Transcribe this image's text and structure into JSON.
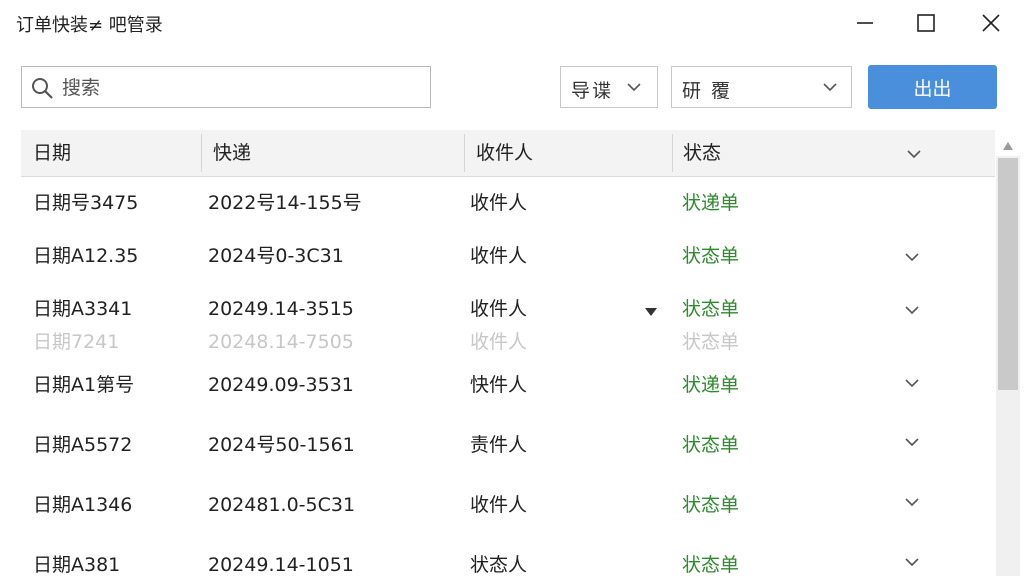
{
  "window": {
    "title": "订单快装≠ 吧管录",
    "controls": [
      "minimize-icon",
      "maximize-icon",
      "close-icon"
    ]
  },
  "toolbar": {
    "search_placeholder": "搜索",
    "dropdown1_label": "导谍",
    "dropdown2_label": "研 覆",
    "primary_button_label": "出出"
  },
  "table": {
    "columns": [
      "日期",
      "快递",
      "收件人",
      "状态"
    ],
    "rows": [
      {
        "date": "日期号3475",
        "express": "2022号14-155号",
        "recipient": "收件人",
        "status": "状递单",
        "chevron": false,
        "triangle": false
      },
      {
        "date": "日期A12.35",
        "express": "2024号0-3С31",
        "recipient": "收件人",
        "status": "状态单",
        "chevron": true,
        "triangle": false
      },
      {
        "date": "日期A3341",
        "express": "20249.14-3515",
        "recipient": "收件人",
        "status": "状态单",
        "chevron": true,
        "triangle": true
      },
      {
        "date": "日期A1第号",
        "express": "20249.09-3531",
        "recipient": "快件人",
        "status": "状递单",
        "chevron": true,
        "triangle": false
      },
      {
        "date": "日期A5572",
        "express": "2024号50-1561",
        "recipient": "责件人",
        "status": "状态单",
        "chevron": true,
        "triangle": false
      },
      {
        "date": "日期A1346",
        "express": "202481.0-5С31",
        "recipient": "收件人",
        "status": "状态单",
        "chevron": true,
        "triangle": false
      },
      {
        "date": "日期A381",
        "express": "20249.14-1051",
        "recipient": "状态人",
        "status": "状态单",
        "chevron": true,
        "triangle": false
      }
    ],
    "ghost_row": {
      "date": "日期7241",
      "express": "20248.14-7505",
      "recipient": "收件人",
      "status": "状态单"
    }
  },
  "colors": {
    "accent": "#4a8fdb",
    "status_green": "#2e8b2e",
    "header_bg": "#f3f3f3"
  }
}
